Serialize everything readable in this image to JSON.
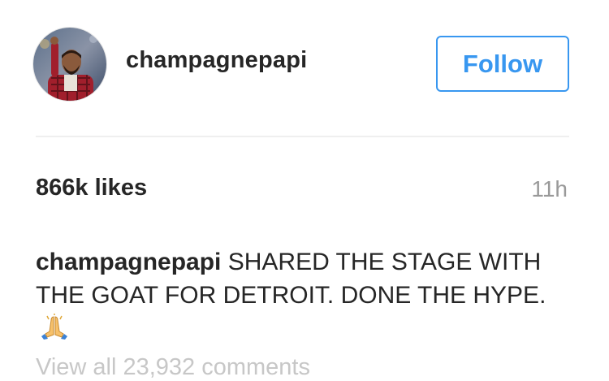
{
  "post": {
    "username": "champagnepapi",
    "follow_label": "Follow",
    "likes": "866k likes",
    "timestamp": "11h",
    "caption_user": "champagnepapi",
    "caption_text": "SHARED THE STAGE WITH THE GOAT FOR DETROIT. DONE THE HYPE.",
    "caption_emoji": "folded-hands-icon",
    "comments_link": "View all 23,932 comments"
  },
  "colors": {
    "accent": "#3897f0",
    "text": "#262626",
    "muted": "#999999",
    "divider": "#efefef"
  }
}
